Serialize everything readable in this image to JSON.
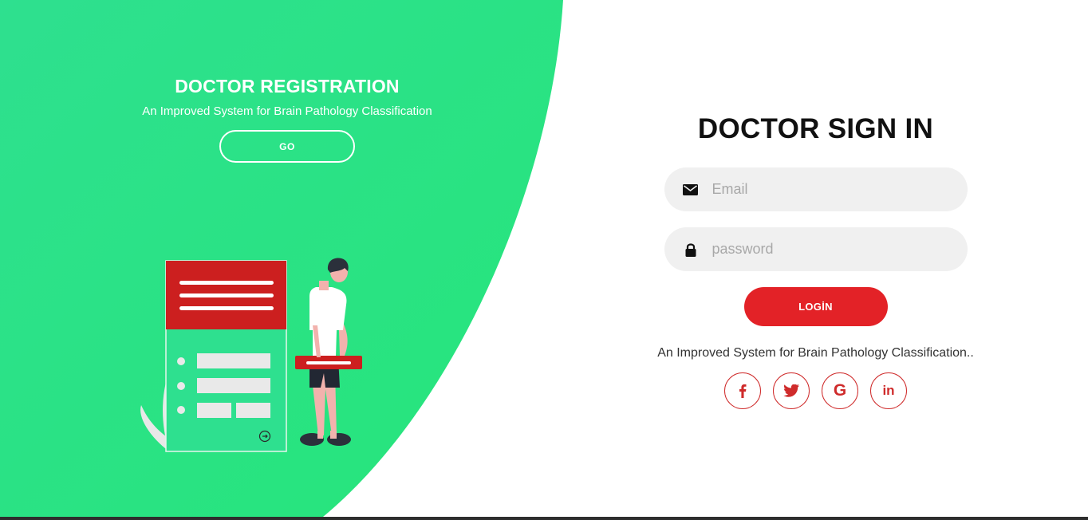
{
  "colors": {
    "green": "#27e383",
    "red": "#e32227",
    "field_bg": "#f0f0f0",
    "title": "#111111"
  },
  "registration": {
    "title": "DOCTOR REGISTRATION",
    "subtitle": "An Improved System for Brain Pathology Classification",
    "go_label": "GO"
  },
  "signin": {
    "title": "DOCTOR SIGN IN",
    "email": {
      "placeholder": "Email",
      "value": "",
      "icon": "envelope-icon"
    },
    "password": {
      "placeholder": "password",
      "value": "",
      "icon": "lock-icon"
    },
    "login_label": "LOGİN",
    "tagline": "An Improved System for Brain Pathology Classification.."
  },
  "social": [
    {
      "name": "facebook-icon",
      "glyph": "f"
    },
    {
      "name": "twitter-icon",
      "glyph": "t"
    },
    {
      "name": "google-icon",
      "glyph": "G"
    },
    {
      "name": "linkedin-icon",
      "glyph": "in"
    }
  ]
}
